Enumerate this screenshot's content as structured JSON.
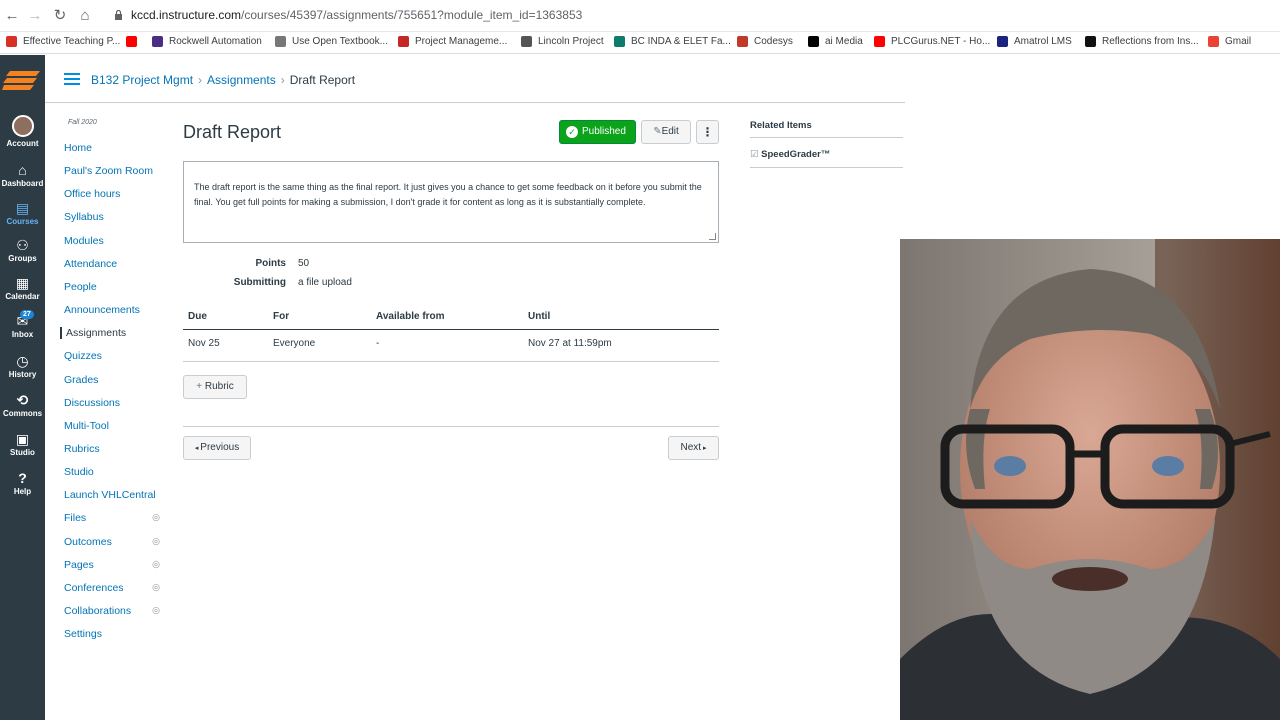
{
  "browser": {
    "url_host": "kccd.instructure.com",
    "url_path": "/courses/45397/assignments/755651?module_item_id=1363853",
    "bookmarks": [
      {
        "label": "Effective Teaching P...",
        "color": "#d93025"
      },
      {
        "label": "",
        "color": "#ff0000"
      },
      {
        "label": "Rockwell Automation",
        "color": "#4b2e83"
      },
      {
        "label": "Use Open Textbook...",
        "color": "#777777"
      },
      {
        "label": "Project Manageme...",
        "color": "#c62828"
      },
      {
        "label": "Lincoln Project",
        "color": "#555555"
      },
      {
        "label": "BC INDA & ELET Fa...",
        "color": "#0f7b6c"
      },
      {
        "label": "Codesys",
        "color": "#c0392b"
      },
      {
        "label": "ai Media",
        "color": "#000000"
      },
      {
        "label": "PLCGurus.NET - Ho...",
        "color": "#ff0000"
      },
      {
        "label": "Amatrol LMS",
        "color": "#1a237e"
      },
      {
        "label": "Reflections from Ins...",
        "color": "#111111"
      },
      {
        "label": "Gmail",
        "color": "#ea4335"
      }
    ]
  },
  "global_nav": {
    "items": [
      {
        "label": "Account",
        "icon": "avatar"
      },
      {
        "label": "Dashboard",
        "icon": "dashboard-icon"
      },
      {
        "label": "Courses",
        "icon": "courses-icon",
        "active": true
      },
      {
        "label": "Groups",
        "icon": "groups-icon"
      },
      {
        "label": "Calendar",
        "icon": "calendar-icon"
      },
      {
        "label": "Inbox",
        "icon": "inbox-icon",
        "badge": "27"
      },
      {
        "label": "History",
        "icon": "history-icon"
      },
      {
        "label": "Commons",
        "icon": "commons-icon"
      },
      {
        "label": "Studio",
        "icon": "studio-icon"
      },
      {
        "label": "Help",
        "icon": "help-icon"
      }
    ]
  },
  "breadcrumb": {
    "course": "B132 Project Mgmt",
    "section": "Assignments",
    "current": "Draft Report"
  },
  "course_nav": {
    "term": "Fall 2020",
    "items": [
      {
        "label": "Home"
      },
      {
        "label": "Paul's Zoom Room"
      },
      {
        "label": "Office hours"
      },
      {
        "label": "Syllabus"
      },
      {
        "label": "Modules"
      },
      {
        "label": "Attendance"
      },
      {
        "label": "People"
      },
      {
        "label": "Announcements"
      },
      {
        "label": "Assignments",
        "active": true
      },
      {
        "label": "Quizzes"
      },
      {
        "label": "Grades"
      },
      {
        "label": "Discussions"
      },
      {
        "label": "Multi-Tool"
      },
      {
        "label": "Rubrics"
      },
      {
        "label": "Studio"
      },
      {
        "label": "Launch VHLCentral"
      },
      {
        "label": "Files",
        "hidden": true
      },
      {
        "label": "Outcomes",
        "hidden": true
      },
      {
        "label": "Pages",
        "hidden": true
      },
      {
        "label": "Conferences",
        "hidden": true
      },
      {
        "label": "Collaborations",
        "hidden": true
      },
      {
        "label": "Settings"
      }
    ]
  },
  "assignment": {
    "title": "Draft Report",
    "published_label": "Published",
    "edit_label": "Edit",
    "description": "The draft report is the same thing as the final report.  It just gives you a chance to get some feedback on it before you submit the final.  You get full points for making a submission, I don't grade it for content as long as it is substantially complete.",
    "points_label": "Points",
    "points_value": "50",
    "submitting_label": "Submitting",
    "submitting_value": "a file upload",
    "due_headers": {
      "due": "Due",
      "for": "For",
      "available": "Available from",
      "until": "Until"
    },
    "due_row": {
      "due": "Nov 25",
      "for": "Everyone",
      "available": "-",
      "until": "Nov 27 at 11:59pm"
    },
    "rubric_label": "Rubric",
    "prev_label": "Previous",
    "next_label": "Next"
  },
  "related": {
    "header": "Related Items",
    "speedgrader": "SpeedGrader™"
  },
  "colors": {
    "canvas_nav": "#2d3b45",
    "link": "#0374b5",
    "published": "#0aa31a"
  }
}
